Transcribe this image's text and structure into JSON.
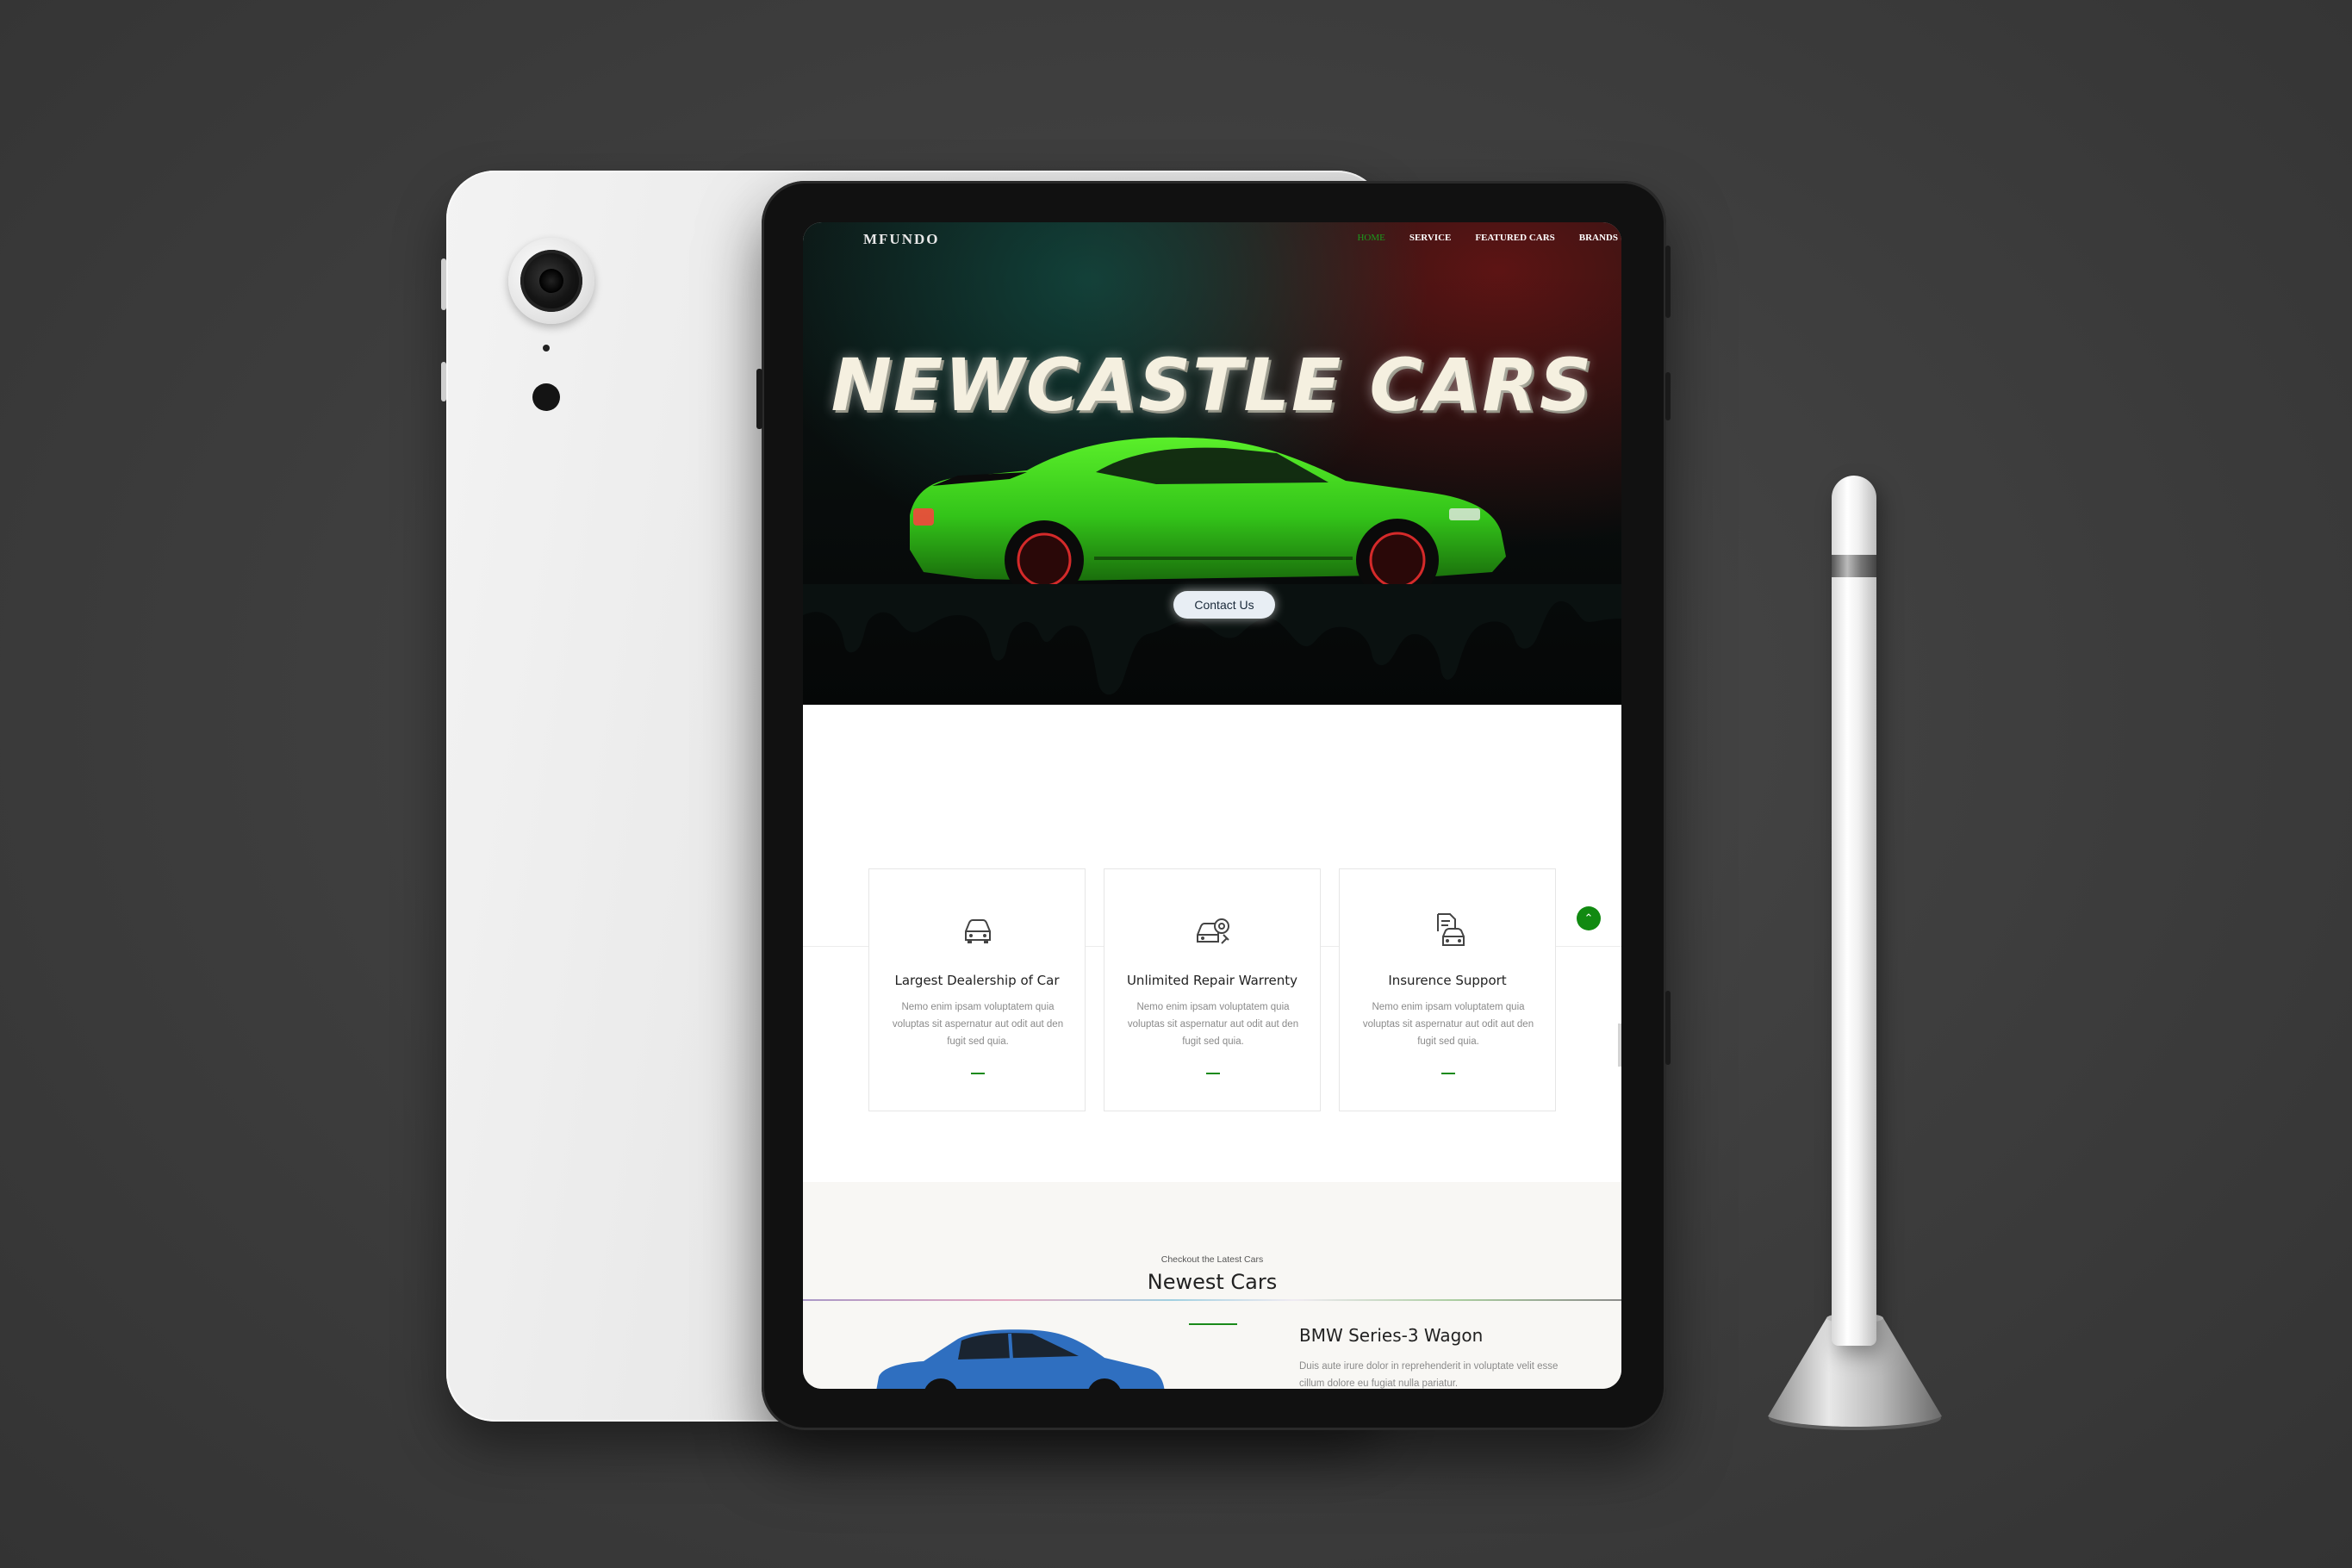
{
  "nav": {
    "logo": "MFUNDO",
    "links": [
      "HOME",
      "SERVICE",
      "FEATURED CARS",
      "BRANDS"
    ],
    "active": "HOME"
  },
  "hero": {
    "title": "NEWCASTLE CARS",
    "cta": "Contact Us"
  },
  "features": [
    {
      "icon": "car-front-icon",
      "title": "Largest Dealership of Car",
      "text": "Nemo enim ipsam voluptatem quia voluptas sit aspernatur aut odit aut den fugit sed quia."
    },
    {
      "icon": "car-repair-icon",
      "title": "Unlimited Repair Warrenty",
      "text": "Nemo enim ipsam voluptatem quia voluptas sit aspernatur aut odit aut den fugit sed quia."
    },
    {
      "icon": "car-insurance-icon",
      "title": "Insurence Support",
      "text": "Nemo enim ipsam voluptatem quia voluptas sit aspernatur aut odit aut den fugit sed quia."
    }
  ],
  "newest": {
    "subtitle": "Checkout the Latest Cars",
    "title": "Newest Cars",
    "car": {
      "name": "BMW Series-3 Wagon",
      "description": "Duis aute irure dolor in reprehenderit in voluptate velit esse cillum dolore eu fugiat nulla pariatur."
    }
  },
  "colors": {
    "accent": "#118a11",
    "hero_car": "#3ecf1a",
    "bmw_car": "#2f6fc0"
  }
}
